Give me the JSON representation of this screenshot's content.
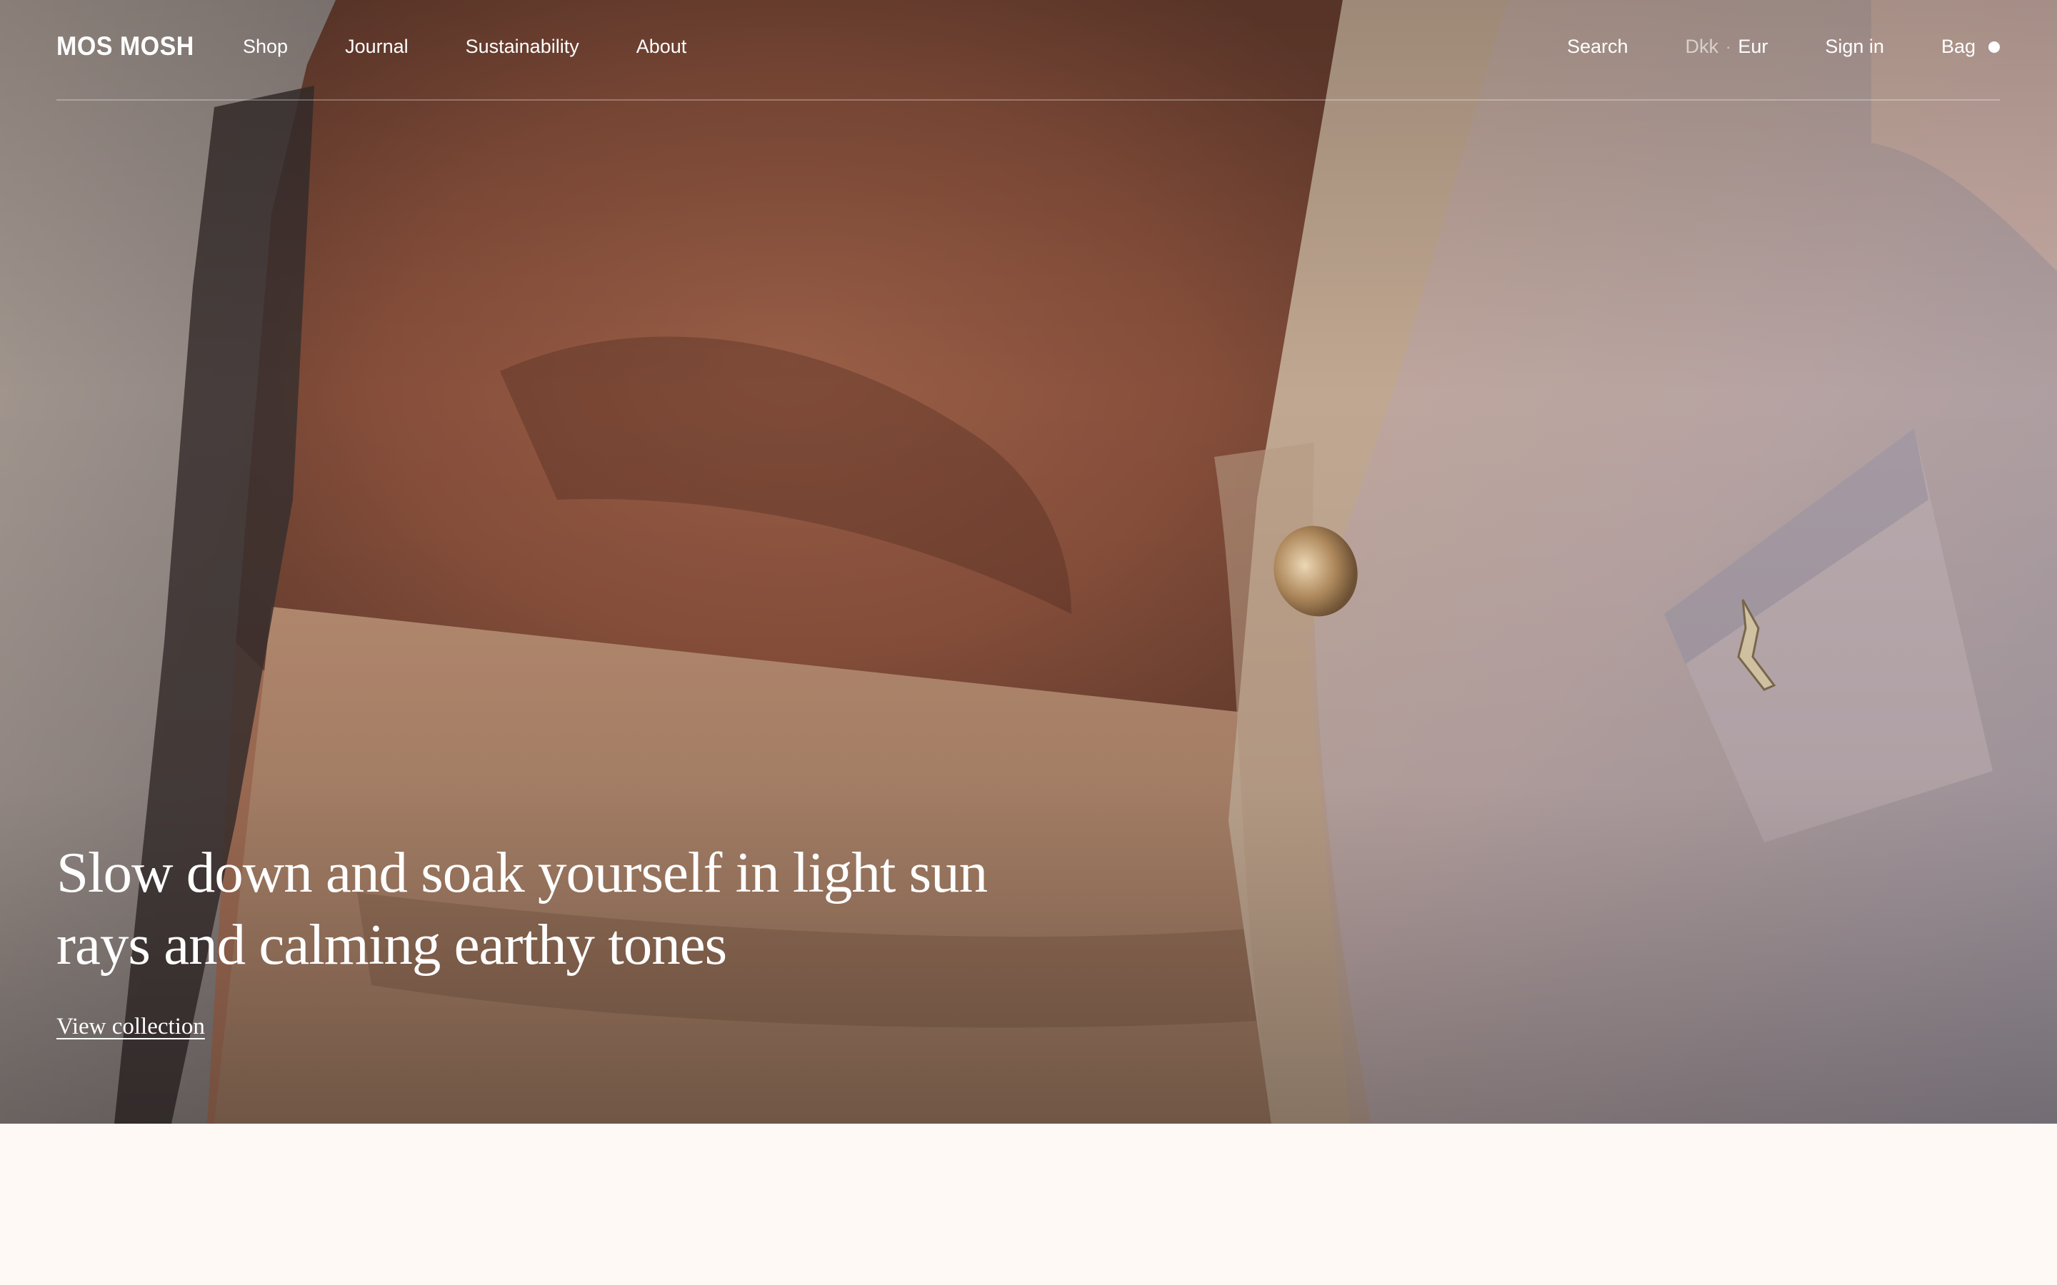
{
  "brand": {
    "logo_text": "MOS MOSH"
  },
  "nav": {
    "links": [
      {
        "label": "Shop"
      },
      {
        "label": "Journal"
      },
      {
        "label": "Sustainability"
      },
      {
        "label": "About"
      }
    ],
    "search_label": "Search",
    "currency": {
      "option_inactive": "Dkk",
      "separator": "·",
      "option_active": "Eur"
    },
    "signin_label": "Sign in",
    "bag_label": "Bag"
  },
  "hero": {
    "headline_line1": "Slow down and soak yourself in light sun",
    "headline_line2": "rays and calming earthy tones",
    "cta_label": "View collection",
    "image_icon": "photo-hero-blazer"
  },
  "colors": {
    "text": "#ffffff",
    "page_background": "#fff9f6",
    "blouse": "#8e5a44",
    "blazer": "#c7aa95"
  }
}
